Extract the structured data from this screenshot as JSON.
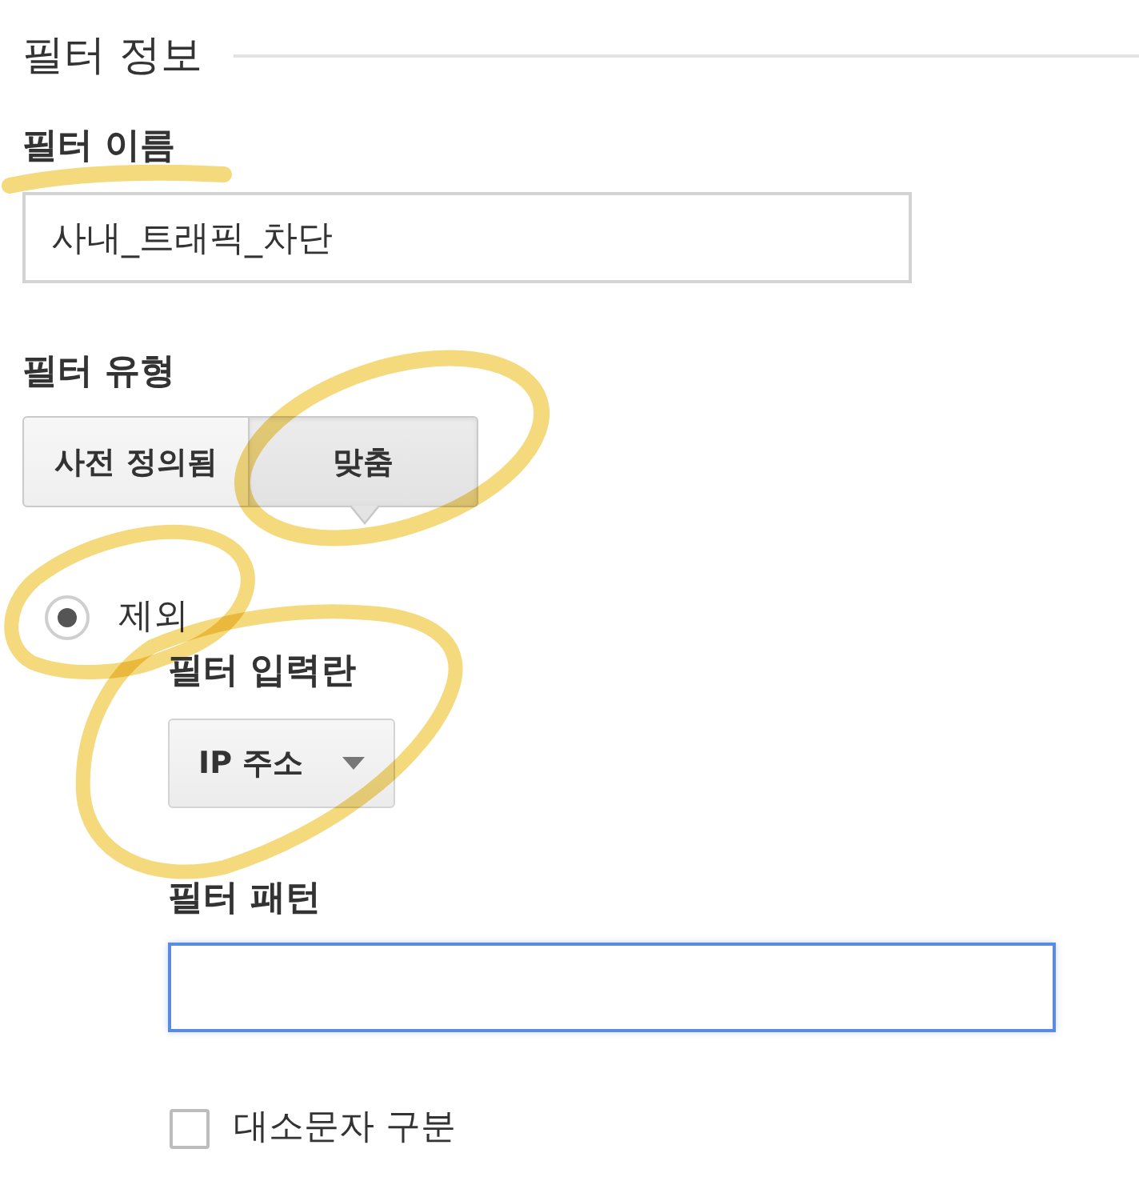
{
  "section": {
    "title": "필터 정보"
  },
  "filter_name": {
    "label": "필터 이름",
    "label_underlined": true,
    "value": "사내_트래픽_차단"
  },
  "filter_type": {
    "label": "필터 유형",
    "options": [
      {
        "label": "사전 정의됨",
        "selected": false,
        "circled": false
      },
      {
        "label": "맞춤",
        "selected": true,
        "circled": true
      }
    ]
  },
  "mode": {
    "label": "제외",
    "selected": true,
    "circled": true
  },
  "filter_field": {
    "label": "필터 입력란",
    "value": "IP 주소",
    "circled": true
  },
  "filter_pattern": {
    "label": "필터 패턴",
    "focused": true
  },
  "case_sensitive": {
    "label": "대소문자 구분",
    "checked": false
  }
}
